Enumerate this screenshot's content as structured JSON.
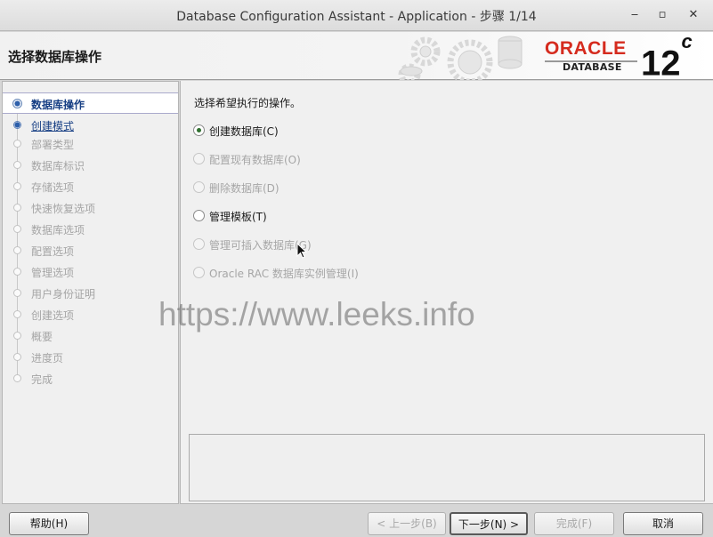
{
  "window": {
    "title": "Database Configuration Assistant - Application - 步骤 1/14",
    "minimize_glyph": "‒",
    "maximize_glyph": "▫",
    "close_glyph": "✕"
  },
  "header": {
    "title": "选择数据库操作",
    "logo_oracle": "ORACLE",
    "logo_database": "DATABASE",
    "logo_version": "12",
    "logo_version_suffix": "c"
  },
  "nav": {
    "items": [
      {
        "label": "数据库操作"
      },
      {
        "label": "创建模式"
      },
      {
        "label": "部署类型"
      },
      {
        "label": "数据库标识"
      },
      {
        "label": "存储选项"
      },
      {
        "label": "快速恢复选项"
      },
      {
        "label": "数据库选项"
      },
      {
        "label": "配置选项"
      },
      {
        "label": "管理选项"
      },
      {
        "label": "用户身份证明"
      },
      {
        "label": "创建选项"
      },
      {
        "label": "概要"
      },
      {
        "label": "进度页"
      },
      {
        "label": "完成"
      }
    ]
  },
  "main": {
    "prompt": "选择希望执行的操作。",
    "options": [
      {
        "label": "创建数据库(C)",
        "selected": true,
        "enabled": true
      },
      {
        "label": "配置现有数据库(O)",
        "selected": false,
        "enabled": false
      },
      {
        "label": "删除数据库(D)",
        "selected": false,
        "enabled": false
      },
      {
        "label": "管理模板(T)",
        "selected": false,
        "enabled": true
      },
      {
        "label": "管理可插入数据库(G)",
        "selected": false,
        "enabled": false
      },
      {
        "label": "Oracle RAC 数据库实例管理(I)",
        "selected": false,
        "enabled": false
      }
    ]
  },
  "watermark": "https://www.leeks.info",
  "buttons": {
    "help": "帮助(H)",
    "back": "< 上一步(B)",
    "next": "下一步(N) >",
    "finish": "完成(F)",
    "cancel": "取消"
  },
  "colors": {
    "oracle_red": "#d52b1e",
    "nav_active_text": "#173f84",
    "disabled_text": "#a6a6a6"
  }
}
